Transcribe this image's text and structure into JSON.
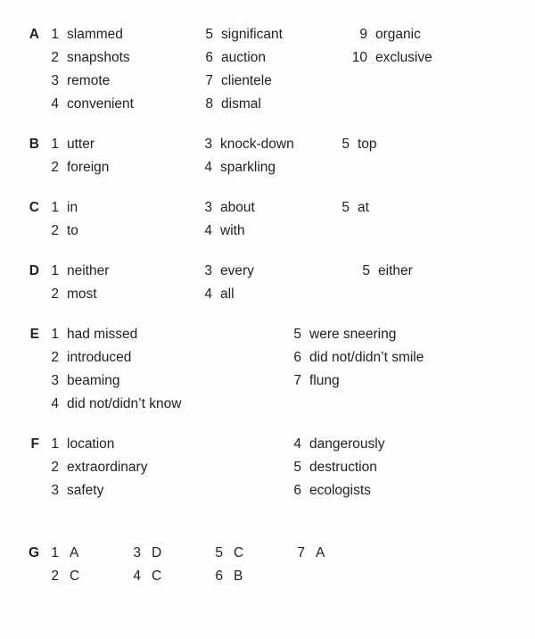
{
  "document": {
    "type": "answer-key",
    "text_color": "#231f20",
    "background_color": "#fdfdfc"
  },
  "sections": [
    {
      "letter": "A",
      "columns": [
        [
          {
            "num": "1",
            "text": "slammed"
          },
          {
            "num": "2",
            "text": "snapshots"
          },
          {
            "num": "3",
            "text": "remote"
          },
          {
            "num": "4",
            "text": "convenient"
          }
        ],
        [
          {
            "num": "5",
            "text": "significant"
          },
          {
            "num": "6",
            "text": "auction"
          },
          {
            "num": "7",
            "text": "clientele"
          },
          {
            "num": "8",
            "text": "dismal"
          }
        ],
        [
          {
            "num": "9",
            "text": "organic"
          },
          {
            "num": "10",
            "text": "exclusive"
          }
        ]
      ]
    },
    {
      "letter": "B",
      "columns": [
        [
          {
            "num": "1",
            "text": "utter"
          },
          {
            "num": "2",
            "text": "foreign"
          }
        ],
        [
          {
            "num": "3",
            "text": "knock-down"
          },
          {
            "num": "4",
            "text": "sparkling"
          }
        ],
        [
          {
            "num": "5",
            "text": "top"
          }
        ]
      ]
    },
    {
      "letter": "C",
      "columns": [
        [
          {
            "num": "1",
            "text": "in"
          },
          {
            "num": "2",
            "text": "to"
          }
        ],
        [
          {
            "num": "3",
            "text": "about"
          },
          {
            "num": "4",
            "text": "with"
          }
        ],
        [
          {
            "num": "5",
            "text": "at"
          }
        ]
      ]
    },
    {
      "letter": "D",
      "columns": [
        [
          {
            "num": "1",
            "text": "neither"
          },
          {
            "num": "2",
            "text": "most"
          }
        ],
        [
          {
            "num": "3",
            "text": "every"
          },
          {
            "num": "4",
            "text": "all"
          }
        ],
        [
          {
            "num": "5",
            "text": "either"
          }
        ]
      ]
    },
    {
      "letter": "E",
      "columns": [
        [
          {
            "num": "1",
            "text": "had missed"
          },
          {
            "num": "2",
            "text": "introduced"
          },
          {
            "num": "3",
            "text": "beaming"
          },
          {
            "num": "4",
            "text": "did not/didn’t know"
          }
        ],
        [
          {
            "num": "5",
            "text": "were sneering"
          },
          {
            "num": "6",
            "text": "did not/didn’t smile"
          },
          {
            "num": "7",
            "text": "flung"
          }
        ]
      ]
    },
    {
      "letter": "F",
      "columns": [
        [
          {
            "num": "1",
            "text": "location"
          },
          {
            "num": "2",
            "text": "extraordinary"
          },
          {
            "num": "3",
            "text": "safety"
          }
        ],
        [
          {
            "num": "4",
            "text": "dangerously"
          },
          {
            "num": "5",
            "text": "destruction"
          },
          {
            "num": "6",
            "text": "ecologists"
          }
        ]
      ]
    },
    {
      "letter": "G",
      "large_gap": true,
      "columns": [
        [
          {
            "num": "1",
            "text": "A"
          },
          {
            "num": "2",
            "text": "C"
          }
        ],
        [
          {
            "num": "3",
            "text": "D"
          },
          {
            "num": "4",
            "text": "C"
          }
        ],
        [
          {
            "num": "5",
            "text": "C"
          },
          {
            "num": "6",
            "text": "B"
          }
        ],
        [
          {
            "num": "7",
            "text": "A"
          }
        ]
      ]
    }
  ]
}
